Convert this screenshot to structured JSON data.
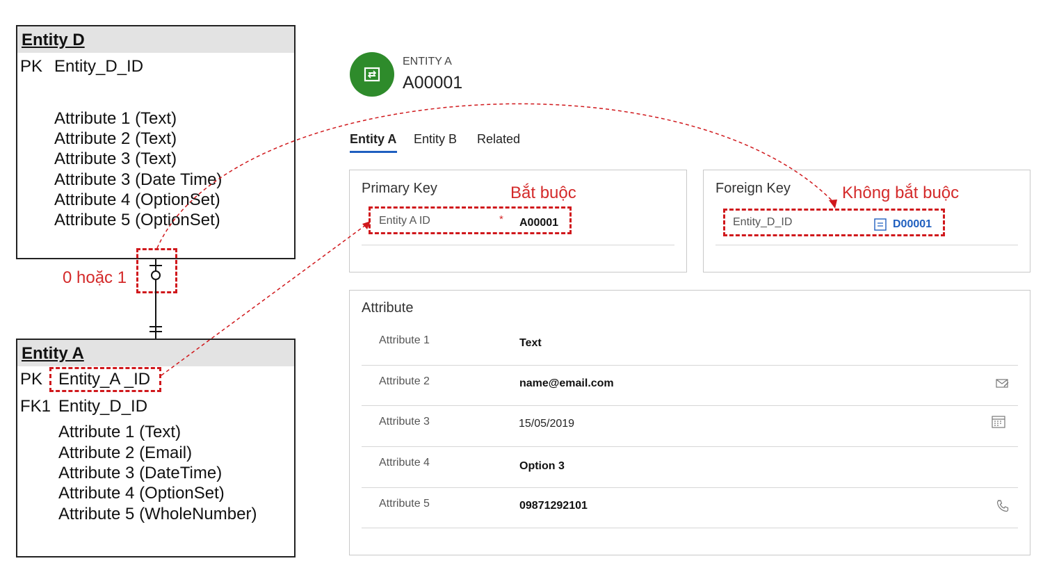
{
  "entity_d": {
    "title": "Entity D",
    "pk_label": "PK",
    "pk_field": "Entity_D_ID",
    "attributes": [
      "Attribute 1 (Text)",
      "Attribute 2 (Text)",
      "Attribute 3 (Text)",
      "Attribute 3 (Date Time)",
      "Attribute 4 (OptionSet)",
      "Attribute 5 (OptionSet)"
    ]
  },
  "entity_a": {
    "title": "Entity A",
    "pk_label": "PK",
    "pk_field": "Entity_A _ID",
    "fk_label": "FK1",
    "fk_field": "Entity_D_ID",
    "attributes": [
      "Attribute 1 (Text)",
      "Attribute 2 (Email)",
      "Attribute 3 (DateTime)",
      "Attribute 4 (OptionSet)",
      "Attribute 5 (WholeNumber)"
    ]
  },
  "relationship_label": "0 hoặc 1",
  "record": {
    "entity_label": "ENTITY A",
    "record_id": "A00001"
  },
  "tabs": [
    "Entity A",
    "Entity B",
    "Related"
  ],
  "primary_key_section": {
    "title": "Primary Key",
    "note": "Bắt buộc",
    "field_label": "Entity A ID",
    "required_mark": "*",
    "field_value": "A00001"
  },
  "foreign_key_section": {
    "title": "Foreign Key",
    "note": "Không bắt buộc",
    "field_label": "Entity_D_ID",
    "field_value": "D00001"
  },
  "attribute_section": {
    "title": "Attribute",
    "rows": [
      {
        "label": "Attribute 1",
        "value": "Text",
        "icon": "none"
      },
      {
        "label": "Attribute 2",
        "value": "name@email.com",
        "icon": "email-icon"
      },
      {
        "label": "Attribute 3",
        "value": "15/05/2019",
        "icon": "calendar-icon"
      },
      {
        "label": "Attribute 4",
        "value": "Option 3",
        "icon": "none"
      },
      {
        "label": "Attribute 5",
        "value": "09871292101",
        "icon": "phone-icon"
      }
    ]
  },
  "colors": {
    "annotation_red": "#d42a2a",
    "avatar_green": "#2e8b2b",
    "tab_underline": "#1f5fbf",
    "lookup_blue": "#1f5fbf"
  }
}
